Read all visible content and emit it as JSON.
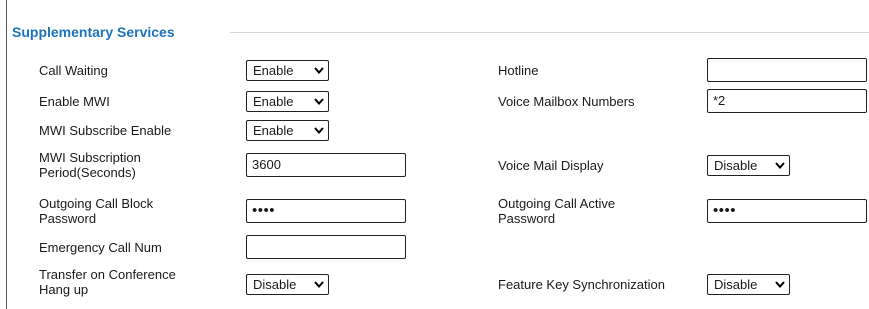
{
  "section": {
    "title": "Supplementary Services"
  },
  "left": {
    "call_waiting": {
      "label": "Call Waiting",
      "value": "Enable"
    },
    "enable_mwi": {
      "label": "Enable MWI",
      "value": "Enable"
    },
    "mwi_subscribe_enable": {
      "label": "MWI Subscribe Enable",
      "value": "Enable"
    },
    "mwi_subscription_period": {
      "label_line1": "MWI Subscription",
      "label_line2": "Period(Seconds)",
      "value": "3600"
    },
    "outgoing_call_block_password": {
      "label_line1": "Outgoing Call Block",
      "label_line2": "Password",
      "value": "••••"
    },
    "emergency_call_num": {
      "label": "Emergency Call Num",
      "value": ""
    },
    "transfer_on_conference_hang_up": {
      "label_line1": "Transfer on Conference",
      "label_line2": "Hang up",
      "value": "Disable"
    }
  },
  "right": {
    "hotline": {
      "label": "Hotline",
      "value": ""
    },
    "voice_mailbox_numbers": {
      "label": "Voice Mailbox Numbers",
      "value": "*2"
    },
    "voice_mail_display": {
      "label": "Voice Mail Display",
      "value": "Disable"
    },
    "outgoing_call_active_password": {
      "label_line1": "Outgoing Call Active",
      "label_line2": "Password",
      "value": "••••"
    },
    "feature_key_synchronization": {
      "label": "Feature Key Synchronization",
      "value": "Disable"
    }
  },
  "icons": {
    "dropdown": "chevron-down-icon"
  },
  "colors": {
    "section_title": "#1e73be"
  }
}
